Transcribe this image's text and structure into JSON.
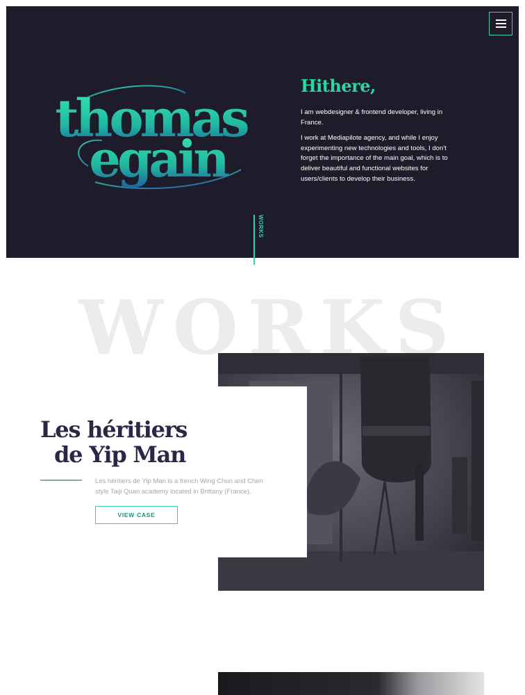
{
  "header": {
    "logo_line1": "thomas",
    "logo_line2": "egain",
    "menu_icon": "hamburger-icon"
  },
  "intro": {
    "greeting": "Hithere,",
    "paragraph1": "I am webdesigner & frontend developer, living in France.",
    "paragraph2": "I work at Mediapilote agency, and while I enjoy experimenting new technologies and tools, I don't forget the importance of the main goal, which is to deliver beautiful and functional websites for users/clients to develop their business."
  },
  "scroll_label": "WORKS",
  "works": {
    "background_title": "WORKS",
    "project": {
      "title_line1": "Les héritiers",
      "title_line2": "de Yip Man",
      "description": "Les héritiers de Yip Man is a french Wing Chun and Chen style Taiji Quan academy located in Brittany (France).",
      "button_label": "VIEW CASE"
    }
  },
  "colors": {
    "hero_bg": "#1e1c2b",
    "accent": "#2cd4a6",
    "title": "#2a2848",
    "muted_text": "#9eaab1"
  }
}
